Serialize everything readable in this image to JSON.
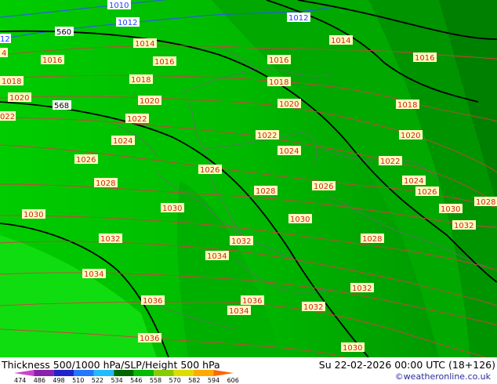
{
  "title": "Thickness 500/1000 hPa/SLP/Height 500 hPa",
  "datetime": "Su 22-02-2026 00:00 UTC (18+126)",
  "credit": "©weatheronline.co.uk",
  "colors": {
    "background_light": "#00cc00",
    "background_dark": "#008800",
    "slp_contour": "#d04040",
    "height_contour": "#000000",
    "thickness_contour": "#2050ff",
    "border": "#555555",
    "label_box": "#ffffc0"
  },
  "scale": {
    "ticks": [
      "474",
      "486",
      "498",
      "510",
      "522",
      "534",
      "546",
      "558",
      "570",
      "582",
      "594",
      "606"
    ],
    "colors": [
      "#cc44cc",
      "#8822aa",
      "#2222cc",
      "#2277ff",
      "#22bbff",
      "#006600",
      "#00bb00",
      "#88cc00",
      "#dddd00",
      "#ffaa00",
      "#ff6600"
    ]
  },
  "thickness_labels": [
    {
      "text": "1010",
      "color": "blue"
    },
    {
      "text": "1012",
      "color": "blue"
    },
    {
      "text": "1012",
      "color": "blue"
    },
    {
      "text": "12",
      "color": "blue"
    }
  ],
  "height_labels": [
    "560",
    "568"
  ],
  "slp_labels": [
    "1014",
    "1014",
    "1016",
    "1016",
    "1016",
    "1016",
    "1018",
    "1018",
    "1018",
    "1018",
    "1020",
    "1020",
    "1020",
    "1020",
    "1020",
    "1022",
    "1022",
    "1022",
    "1022",
    "1024",
    "1024",
    "1024",
    "1026",
    "1026",
    "1026",
    "1026",
    "1028",
    "1028",
    "1028",
    "1028",
    "1030",
    "1030",
    "1030",
    "1030",
    "1032",
    "1032",
    "1032",
    "1032",
    "1034",
    "1034",
    "1034",
    "1036",
    "1036",
    "1036",
    "1030",
    "1032",
    "4",
    "022"
  ]
}
